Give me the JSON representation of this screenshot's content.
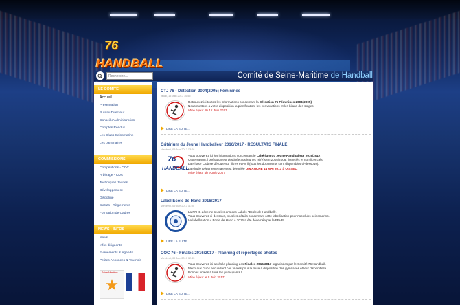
{
  "header": {
    "logo_number": "76",
    "logo_text": "HANDBALL",
    "search_placeholder": "Recherche...",
    "title_part1": "Comité",
    "title_part2": " de Seine-Maritime ",
    "title_part3": "de Handball"
  },
  "sidebar": {
    "sections": [
      {
        "heading": "LE COMITÉ",
        "items": [
          "Accueil",
          "Présentation",
          "Bureau Directeur",
          "Conseil d'Administration",
          "Comptes Rendus",
          "Les Clubs Seinomarins",
          "Les partenaires"
        ]
      },
      {
        "heading": "COMMISSIONS",
        "items": [
          "Compétitions - COC",
          "Arbitrage - CDA",
          "Techniques Jeunes",
          "Développement",
          "Discipline",
          "Statuts - Règlements",
          "Formation de Cadres"
        ]
      },
      {
        "heading": "NEWS - INFOS",
        "items": [
          "News",
          "Infos dirigeants",
          "Evènements & Agenda",
          "Petites Annonces & Tournois"
        ]
      }
    ],
    "logo_caption": "Seine-Maritime"
  },
  "articles": [
    {
      "title": "CTJ 76 - Détection 2004(2005) Féminines",
      "date": "Jeudi, 15 Juin 2017 10:55",
      "line1_pre": "Retrouvez ici toutes les informations concernant la ",
      "line1_bold": "Détection 76 Féminines 2004(2005)",
      "line1_post": ".",
      "line2": "Nous mettons à votre disposition la planification, les convocations et les bilans des stages.",
      "update": "Mise à jour du 15 Juin 2017",
      "more": "LIRE LA SUITE..."
    },
    {
      "title": "Critérium du Jeune Handballeur 2016/2017 - RESULTATS FINALE",
      "date": "Vendredi, 09 Juin 2017 13:08",
      "line1_pre": "Vous trouverez ici les informations concernant le ",
      "line1_bold": "Critérium du Jeune Handballeur 2016/2017",
      "line1_post": ".",
      "line2": "Cette saison, l'opération est destinée aux jeunes né(e)s en 2005/2006, licenciés et non-licenciés.",
      "line3": "La Phase Club se déroule sur filtres et Avril (tous les documents sont disponibles ci-dessous).",
      "line4_pre": "La Finale Départementale s'est déroulée ",
      "line4_red": "DIMANCHE 14 MAI 2017 à OISSEL.",
      "update": "Mise à jour du 9 Juin 2017",
      "more": "LIRE LA SUITE..."
    },
    {
      "title": "Label Ecole de Hand 2016/2017",
      "date": "Vendredi, 09 Juin 2017 11:05",
      "line1_pre": "La FFHB décerne tous les ans des Labels \"Ecole de Handball\".",
      "line2": "Vous trouverez ci-dessous, tous les détails concernant cette labellisation pour nos clubs seinomarins.",
      "line3": "Le labellisation « Ecole de Hand » 2016 a été décernée par la FFHB.",
      "more": "LIRE LA SUITE..."
    },
    {
      "title": "COC 76 - Finales 2016/2017 - Planning et reportages photos",
      "date": "Vendredi, 09 Juin 2017 12:35",
      "line1_pre": "Vous trouverez ici après la planning des ",
      "line1_bold": "Finales 2016/2017",
      "line1_post": " organisées par le Comité 76 Handball.",
      "line2": "Merci aux clubs accueillant ces finales pour la mise à disposition des gymnases et leur disponibilité.",
      "line3": "Bonnes finales à tous les participants !",
      "update": "Mise à jour le 9 Juin 2017",
      "more": "LIRE LA SUITE..."
    }
  ],
  "colors": {
    "accent_orange": "#f0a800",
    "link_blue": "#2d4f8e",
    "highlight_red": "#d01818",
    "bg_blue": "#10285e"
  }
}
